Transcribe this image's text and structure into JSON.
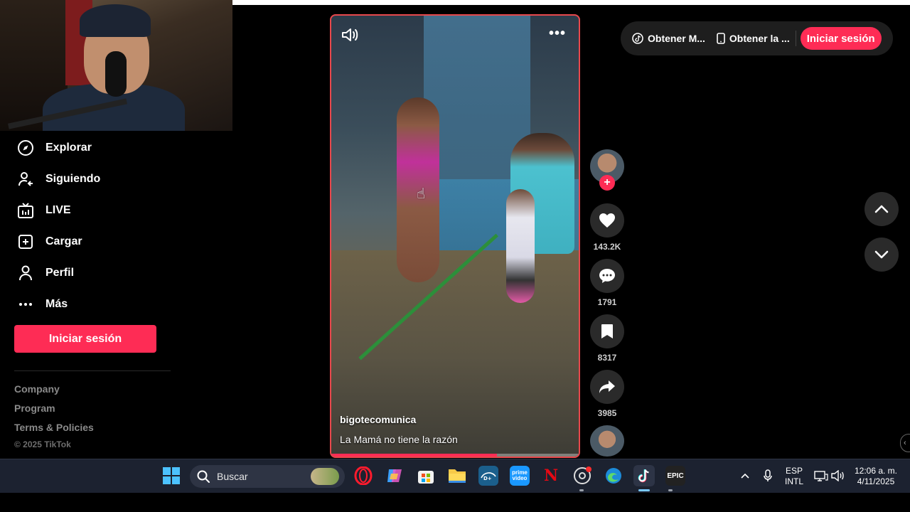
{
  "sidebar": {
    "items": [
      {
        "label": "Explorar",
        "icon": "compass-icon"
      },
      {
        "label": "Siguiendo",
        "icon": "user-follow-icon"
      },
      {
        "label": "LIVE",
        "icon": "live-tv-icon"
      },
      {
        "label": "Cargar",
        "icon": "upload-plus-icon"
      },
      {
        "label": "Perfil",
        "icon": "profile-icon"
      },
      {
        "label": "Más",
        "icon": "more-dots-icon"
      }
    ],
    "login_label": "Iniciar sesión",
    "footer": {
      "company": "Company",
      "program": "Program",
      "terms": "Terms & Policies",
      "copyright": "© 2025 TikTok"
    }
  },
  "video": {
    "author": "bigotecomunica",
    "caption": "La Mamá no tiene la razón",
    "progress": 0.67,
    "more_label": "•••"
  },
  "actions": {
    "likes": "143.2K",
    "comments": "1791",
    "saves": "8317",
    "shares": "3985",
    "follow_label": "+"
  },
  "header": {
    "get_app_label": "Obtener M...",
    "get_desktop_label": "Obtener la ...",
    "login_label": "Iniciar sesión"
  },
  "taskbar": {
    "search_placeholder": "Buscar",
    "lang_line1": "ESP",
    "lang_line2": "INTL",
    "time": "12:06 a. m.",
    "date": "4/11/2025",
    "epic_label": "EPIC",
    "prime_label": "prime video",
    "netflix_label": "N"
  },
  "colors": {
    "accent": "#fe2c55",
    "video_border": "#e8484c",
    "taskbar": "#1c2230"
  }
}
